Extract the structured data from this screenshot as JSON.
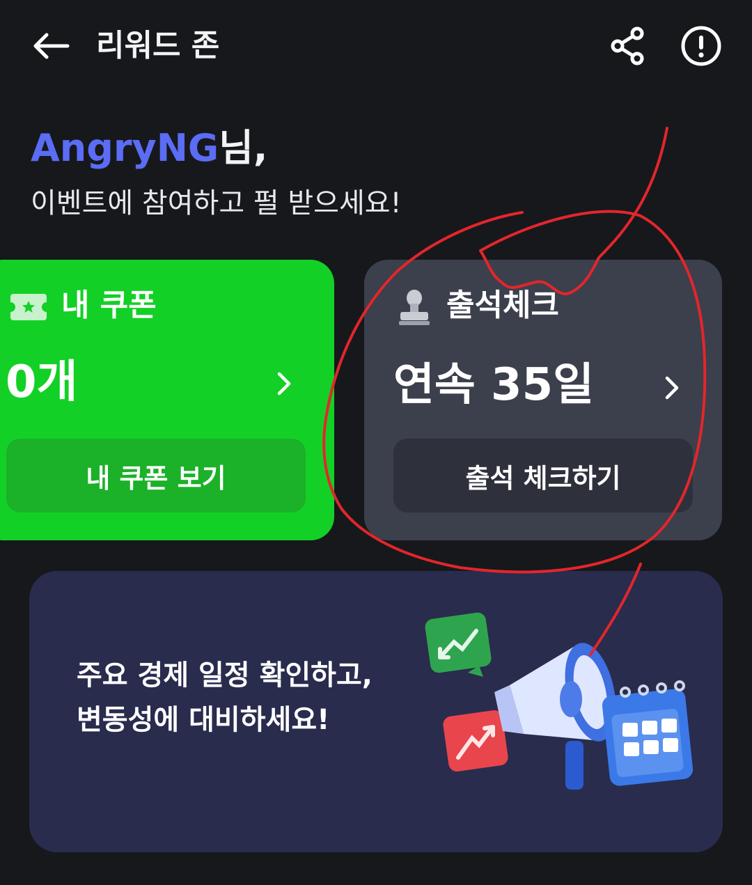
{
  "header": {
    "title": "리워드 존",
    "back_icon": "arrow-left-icon",
    "share_icon": "share-icon",
    "info_icon": "info-circle-icon"
  },
  "greeting": {
    "username": "AngryNG",
    "suffix": "님,",
    "subtitle": "이벤트에 참여하고 펄 받으세요!"
  },
  "coupon_card": {
    "label": "내 쿠폰",
    "value": "0개",
    "button_label": "내 쿠폰 보기",
    "icon": "ticket-icon",
    "color": "#13d026"
  },
  "attendance_card": {
    "label": "출석체크",
    "value": "연속 35일",
    "button_label": "출석 체크하기",
    "icon": "stamp-icon",
    "color": "#3c3f4c"
  },
  "banner": {
    "line1": "주요 경제 일정 확인하고,",
    "line2": "변동성에 대비하세요!",
    "art": "megaphone-calendar-illustration"
  },
  "colors": {
    "background": "#17181c",
    "accent_username": "#5b6cf5",
    "annotation": "#e3262b"
  }
}
